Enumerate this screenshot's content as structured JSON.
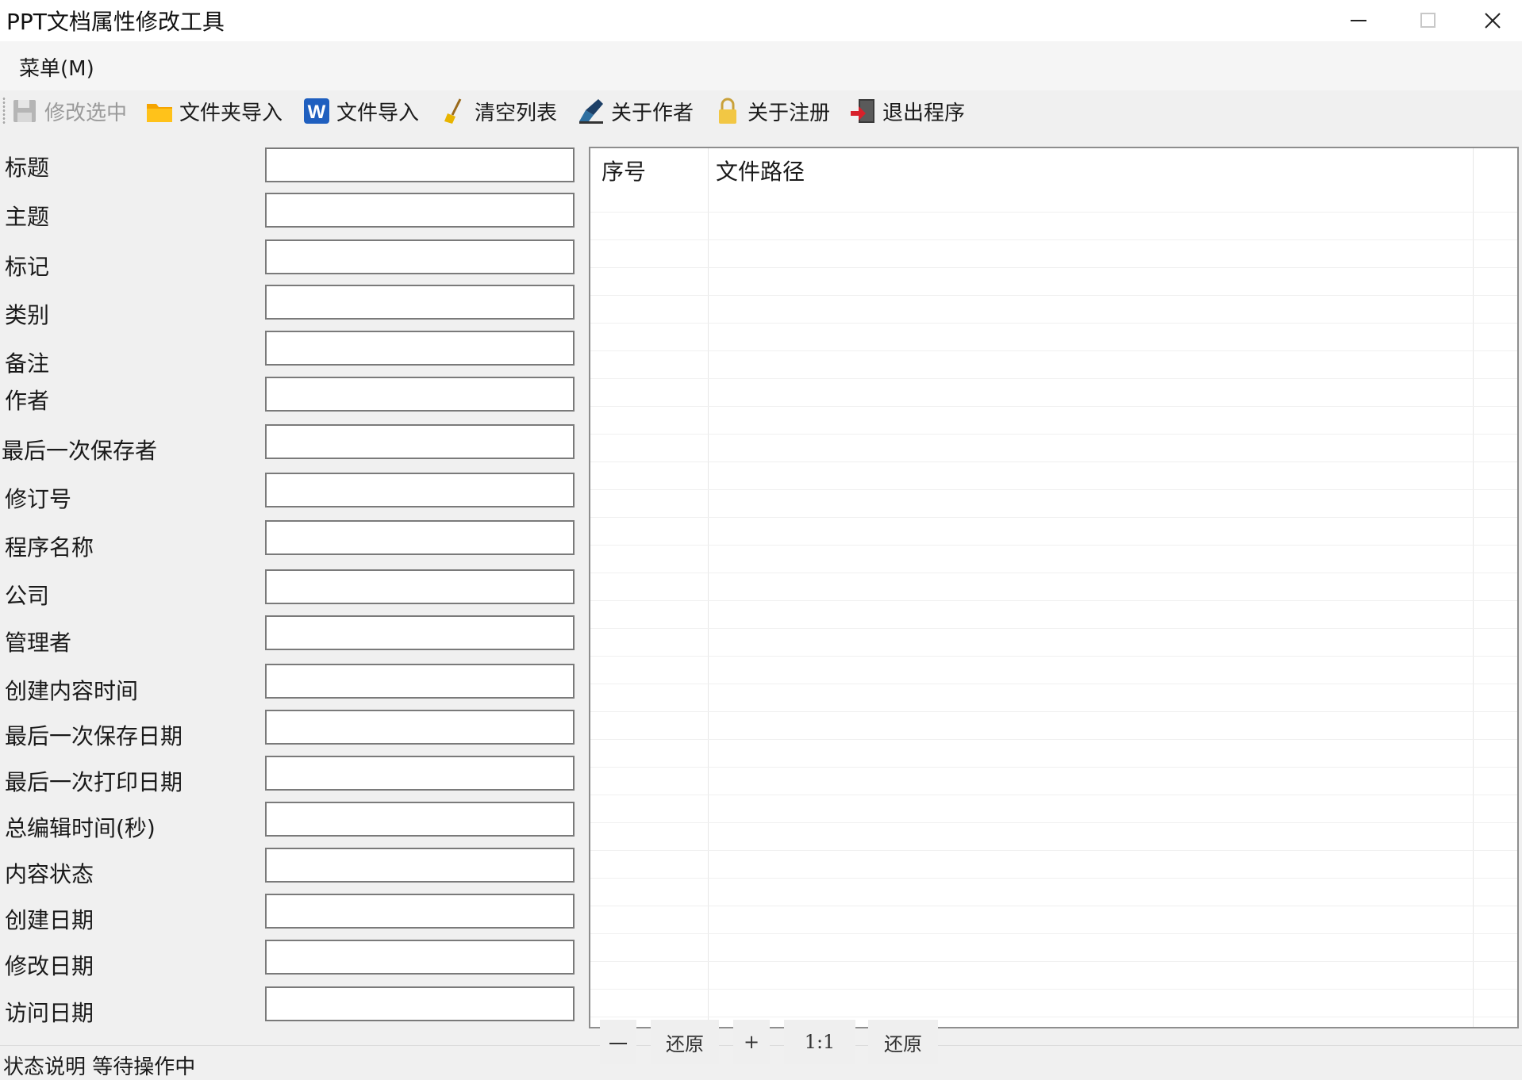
{
  "window": {
    "title": "PPT文档属性修改工具"
  },
  "menu": {
    "items": [
      {
        "label": "菜单(M)"
      }
    ]
  },
  "toolbar": {
    "buttons": [
      {
        "label": "修改选中",
        "icon": "save-icon",
        "enabled": false
      },
      {
        "label": "文件夹导入",
        "icon": "folder-icon",
        "enabled": true
      },
      {
        "label": "文件导入",
        "icon": "word-icon",
        "enabled": true
      },
      {
        "label": "清空列表",
        "icon": "broom-icon",
        "enabled": true
      },
      {
        "label": "关于作者",
        "icon": "author-icon",
        "enabled": true
      },
      {
        "label": "关于注册",
        "icon": "lock-icon",
        "enabled": true
      },
      {
        "label": "退出程序",
        "icon": "exit-icon",
        "enabled": true
      }
    ]
  },
  "form": {
    "fields": [
      {
        "label": "标题",
        "value": ""
      },
      {
        "label": "主题",
        "value": ""
      },
      {
        "label": "标记",
        "value": ""
      },
      {
        "label": "类别",
        "value": ""
      },
      {
        "label": "备注",
        "value": ""
      },
      {
        "label": "作者",
        "value": ""
      },
      {
        "label": "最后一次保存者",
        "value": ""
      },
      {
        "label": "修订号",
        "value": ""
      },
      {
        "label": "程序名称",
        "value": ""
      },
      {
        "label": "公司",
        "value": ""
      },
      {
        "label": "管理者",
        "value": ""
      },
      {
        "label": "创建内容时间",
        "value": ""
      },
      {
        "label": "最后一次保存日期",
        "value": ""
      },
      {
        "label": "最后一次打印日期",
        "value": ""
      },
      {
        "label": "总编辑时间(秒)",
        "value": ""
      },
      {
        "label": "内容状态",
        "value": ""
      },
      {
        "label": "创建日期",
        "value": ""
      },
      {
        "label": "修改日期",
        "value": ""
      },
      {
        "label": "访问日期",
        "value": ""
      }
    ]
  },
  "list": {
    "columns": [
      "序号",
      "文件路径"
    ],
    "rows": []
  },
  "zoom": {
    "minus": "一",
    "restore1": "还原",
    "plus": "+",
    "ratio": "1:1",
    "restore2": "还原"
  },
  "status": {
    "text": "状态说明  等待操作中"
  }
}
